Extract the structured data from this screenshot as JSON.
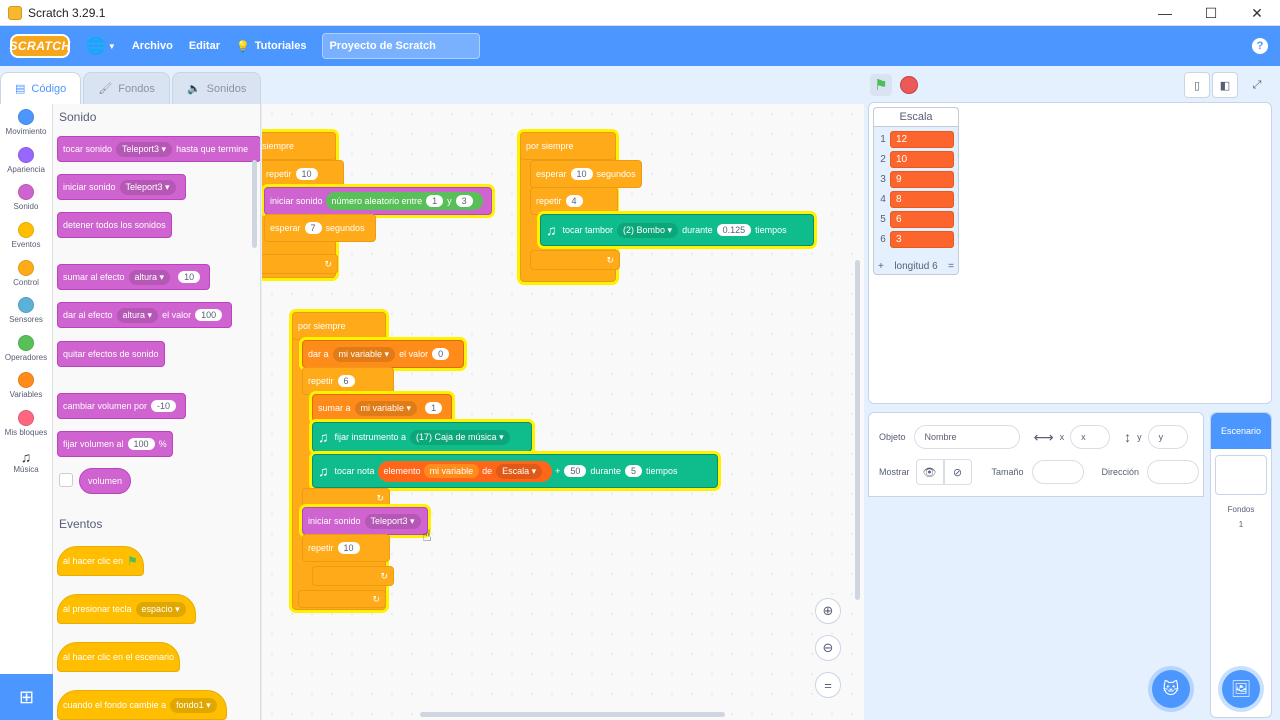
{
  "window": {
    "title": "Scratch 3.29.1",
    "min": "—",
    "max": "☐",
    "close": "✕"
  },
  "menubar": {
    "logo": "SCRATCH",
    "file": "Archivo",
    "edit": "Editar",
    "tutorials": "Tutoriales",
    "project_title": "Proyecto de Scratch",
    "help": "?"
  },
  "tabs": [
    {
      "label": "Código"
    },
    {
      "label": "Fondos"
    },
    {
      "label": "Sonidos"
    }
  ],
  "categories": [
    {
      "label": "Movimiento",
      "color": "#4c97ff"
    },
    {
      "label": "Apariencia",
      "color": "#9966ff"
    },
    {
      "label": "Sonido",
      "color": "#cf63cf"
    },
    {
      "label": "Eventos",
      "color": "#ffbf00"
    },
    {
      "label": "Control",
      "color": "#ffab19"
    },
    {
      "label": "Sensores",
      "color": "#5cb1d6"
    },
    {
      "label": "Operadores",
      "color": "#59c059"
    },
    {
      "label": "Variables",
      "color": "#ff8c1a"
    },
    {
      "label": "Mis bloques",
      "color": "#ff6680"
    },
    {
      "label": "Música",
      "icon": "music-note-icon"
    }
  ],
  "palette": {
    "sound_heading": "Sonido",
    "events_heading": "Eventos",
    "b1": {
      "a": "tocar sonido",
      "dd": "Teleport3 ▾",
      "b": "hasta que termine"
    },
    "b2": {
      "a": "iniciar sonido",
      "dd": "Teleport3 ▾"
    },
    "b3": {
      "a": "detener todos los sonidos"
    },
    "b4": {
      "a": "sumar al efecto",
      "dd": "altura ▾",
      "v": "10"
    },
    "b5": {
      "a": "dar al efecto",
      "dd": "altura ▾",
      "b": "el valor",
      "v": "100"
    },
    "b6": {
      "a": "quitar efectos de sonido"
    },
    "b7": {
      "a": "cambiar volumen por",
      "v": "-10"
    },
    "b8": {
      "a": "fijar volumen al",
      "v": "100",
      "b": "%"
    },
    "b9": {
      "a": "volumen"
    },
    "e1": {
      "a": "al hacer clic en"
    },
    "e2": {
      "a": "al presionar tecla",
      "dd": "espacio ▾"
    },
    "e3": {
      "a": "al hacer clic en el escenario"
    },
    "e4": {
      "a": "cuando el fondo cambie a",
      "dd": "fondo1 ▾"
    }
  },
  "script1": {
    "forever": "siempre",
    "repeat": "repetir",
    "repeat_n": "10",
    "start_sound": "iniciar sonido",
    "random": "número aleatorio entre",
    "r1": "1",
    "and": "y",
    "r2": "3",
    "wait": "esperar",
    "wait_n": "7",
    "seconds": "segundos"
  },
  "script2": {
    "forever": "por siempre",
    "wait": "esperar",
    "wait_n": "10",
    "seconds": "segundos",
    "repeat": "repetir",
    "repeat_n": "4",
    "drum": "tocar tambor",
    "drum_dd": "(2) Bombo ▾",
    "during": "durante",
    "beats_n": "0.125",
    "beats": "tiempos"
  },
  "script3": {
    "forever": "por siempre",
    "set": "dar a",
    "var": "mi variable ▾",
    "value_lbl": "el valor",
    "value": "0",
    "repeat": "repetir",
    "repeat_n": "6",
    "change": "sumar a",
    "change_var": "mi variable ▾",
    "change_n": "1",
    "instrument": "fijar instrumento a",
    "instrument_dd": "(17) Caja de música ▾",
    "play_note": "tocar nota",
    "item": "elemento",
    "item_var": "mi variable",
    "of": "de",
    "list_dd": "Escala ▾",
    "plus": "+",
    "plus_n": "50",
    "during": "durante",
    "beats_n": "5",
    "beats": "tiempos",
    "start_sound": "iniciar sonido",
    "sound_dd": "Teleport3 ▾",
    "repeat2": "repetir",
    "repeat2_n": "10"
  },
  "list_monitor": {
    "title": "Escala",
    "items": [
      {
        "i": "1",
        "v": "12"
      },
      {
        "i": "2",
        "v": "10"
      },
      {
        "i": "3",
        "v": "9"
      },
      {
        "i": "4",
        "v": "8"
      },
      {
        "i": "5",
        "v": "6"
      },
      {
        "i": "6",
        "v": "3"
      }
    ],
    "plus": "+",
    "length": "longitud 6",
    "eq": "="
  },
  "sprite_info": {
    "object": "Objeto",
    "name_ph": "Nombre",
    "x": "x",
    "x_ph": "x",
    "y": "y",
    "y_ph": "y",
    "show": "Mostrar",
    "size": "Tamaño",
    "direction": "Dirección"
  },
  "stage_selector": {
    "header": "Escenario",
    "backdrops": "Fondos",
    "count": "1"
  }
}
